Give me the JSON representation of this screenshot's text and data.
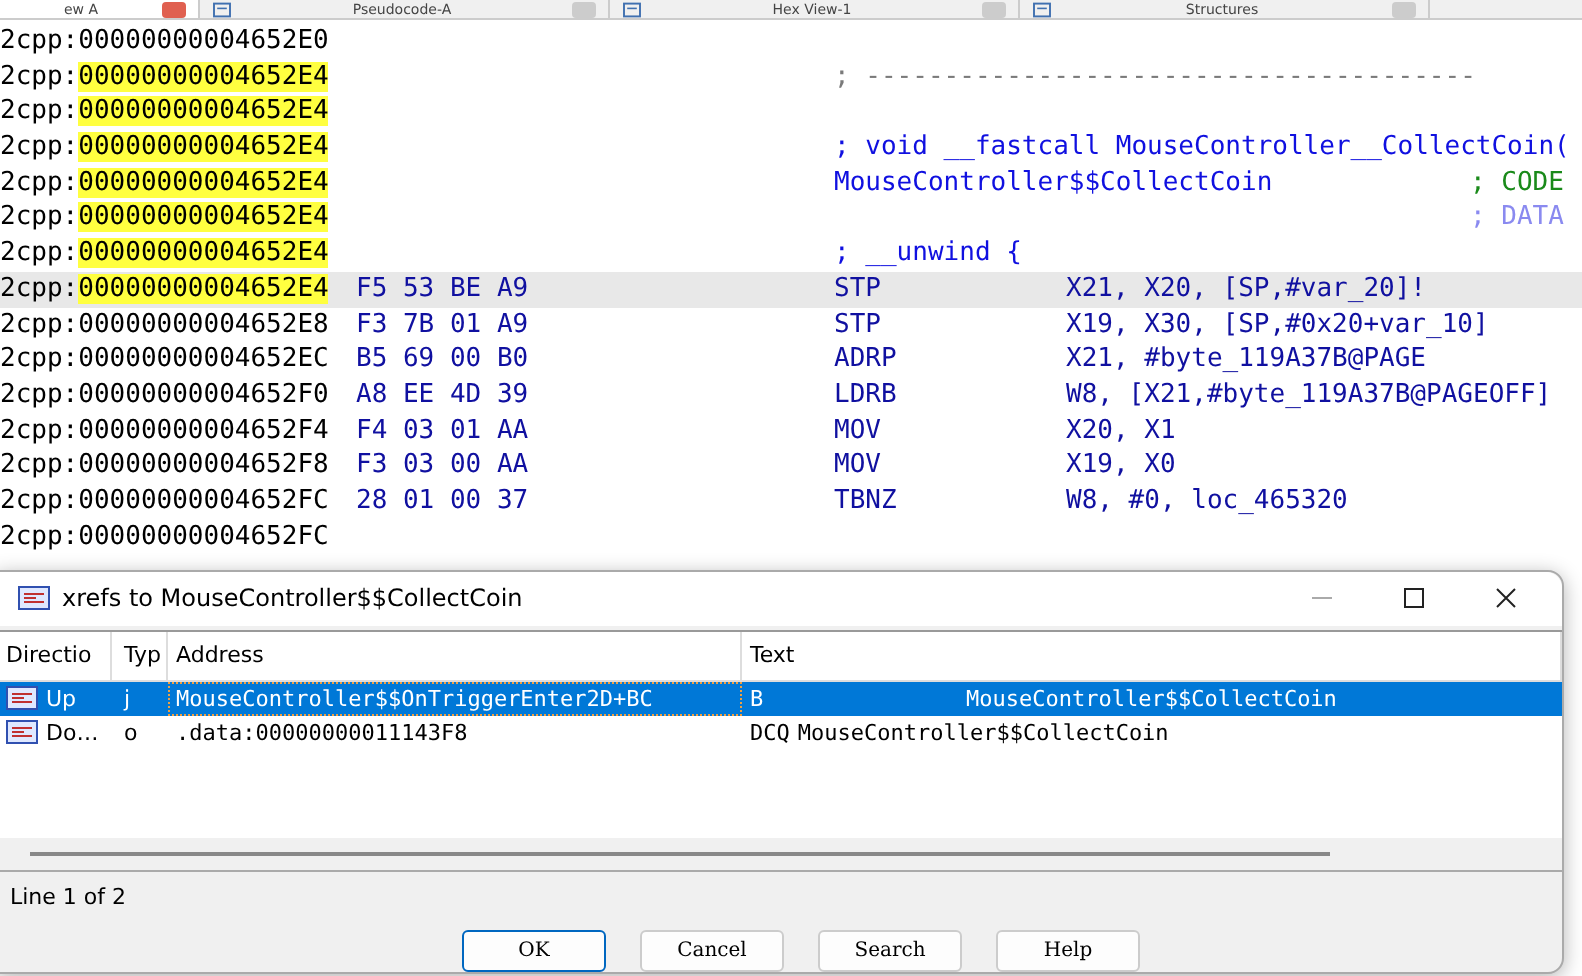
{
  "tabs": [
    {
      "label": "ew A",
      "selected": true
    },
    {
      "label": "Pseudocode-A",
      "selected": false
    },
    {
      "label": "Hex View-1",
      "selected": false
    },
    {
      "label": "Structures",
      "selected": false
    }
  ],
  "listing": [
    {
      "segment": "2cpp:",
      "address": "00000000004652E0",
      "highlight": false,
      "current": false
    },
    {
      "segment": "2cpp:",
      "address": "00000000004652E4",
      "highlight": true,
      "current": false,
      "comment": "; ---------------------------------------",
      "color": "#7a7a7a"
    },
    {
      "segment": "2cpp:",
      "address": "00000000004652E4",
      "highlight": true,
      "current": false
    },
    {
      "segment": "2cpp:",
      "address": "00000000004652E4",
      "highlight": true,
      "current": false,
      "comment": "; void __fastcall MouseController__CollectCoin(",
      "color": "#1010e0"
    },
    {
      "segment": "2cpp:",
      "address": "00000000004652E4",
      "highlight": true,
      "current": false,
      "label": "MouseController$$CollectCoin",
      "xref": "; CODE",
      "color": "#1a8a1a"
    },
    {
      "segment": "2cpp:",
      "address": "00000000004652E4",
      "highlight": true,
      "current": false,
      "xref": "; DATA",
      "color": "#8a8af0"
    },
    {
      "segment": "2cpp:",
      "address": "00000000004652E4",
      "highlight": true,
      "current": false,
      "comment": "; __unwind {",
      "color": "#1010e0"
    },
    {
      "segment": "2cpp:",
      "address": "00000000004652E4",
      "highlight": true,
      "current": true,
      "bytes": "F5 53 BE A9",
      "mnemonic": "STP",
      "operands": "X21, X20, [SP,#var_20]!"
    },
    {
      "segment": "2cpp:",
      "address": "00000000004652E8",
      "highlight": false,
      "current": false,
      "bytes": "F3 7B 01 A9",
      "mnemonic": "STP",
      "operands": "X19, X30, [SP,#0x20+var_10]"
    },
    {
      "segment": "2cpp:",
      "address": "00000000004652EC",
      "highlight": false,
      "current": false,
      "bytes": "B5 69 00 B0",
      "mnemonic": "ADRP",
      "operands": "X21, #byte_119A37B@PAGE"
    },
    {
      "segment": "2cpp:",
      "address": "00000000004652F0",
      "highlight": false,
      "current": false,
      "bytes": "A8 EE 4D 39",
      "mnemonic": "LDRB",
      "operands": "W8, [X21,#byte_119A37B@PAGEOFF]"
    },
    {
      "segment": "2cpp:",
      "address": "00000000004652F4",
      "highlight": false,
      "current": false,
      "bytes": "F4 03 01 AA",
      "mnemonic": "MOV",
      "operands": "X20, X1"
    },
    {
      "segment": "2cpp:",
      "address": "00000000004652F8",
      "highlight": false,
      "current": false,
      "bytes": "F3 03 00 AA",
      "mnemonic": "MOV",
      "operands": "X19, X0"
    },
    {
      "segment": "2cpp:",
      "address": "00000000004652FC",
      "highlight": false,
      "current": false,
      "bytes": "28 01 00 37",
      "mnemonic": "TBNZ",
      "operands": "W8, #0, loc_465320"
    },
    {
      "segment": "2cpp:",
      "address": "00000000004652FC",
      "highlight": false,
      "current": false
    }
  ],
  "dialog": {
    "title": "xrefs to MouseController$$CollectCoin",
    "columns": [
      "Directio",
      "Typ",
      "Address",
      "Text"
    ],
    "rows": [
      {
        "direction": "Up",
        "type": "j",
        "address": "MouseController$$OnTriggerEnter2D+BC",
        "text_1": "B",
        "text_2": "MouseController$$CollectCoin",
        "selected": true
      },
      {
        "direction": "Do…",
        "type": "o",
        "address": ".data:00000000011143F8",
        "text_1": "DCQ",
        "text_2": "MouseController$$CollectCoin",
        "selected": false
      }
    ],
    "status": "Line 1 of 2",
    "buttons": [
      {
        "label": "OK",
        "default": true
      },
      {
        "label": "Cancel",
        "default": false
      },
      {
        "label": "Search",
        "default": false
      },
      {
        "label": "Help",
        "default": false
      }
    ]
  }
}
